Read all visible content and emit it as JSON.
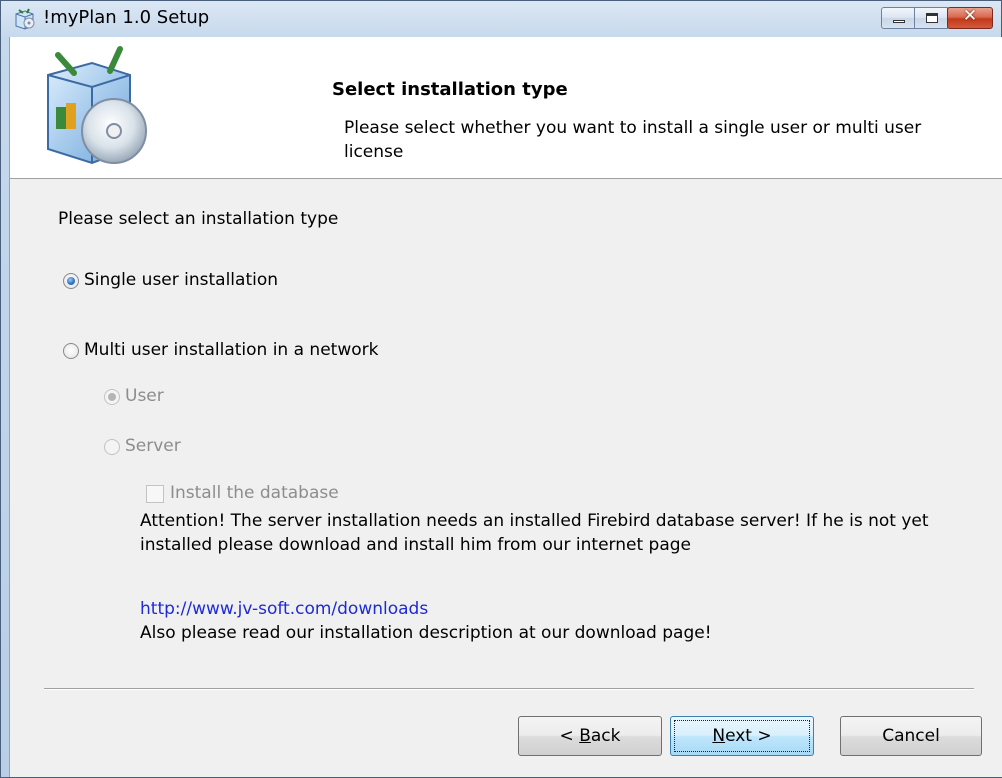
{
  "window": {
    "title": "!myPlan 1.0 Setup",
    "icon": "installer-box-icon",
    "controls": [
      "minimize-icon",
      "maximize-icon",
      "close-icon"
    ]
  },
  "header": {
    "title": "Select installation type",
    "subtitle": "Please select whether you want to install a single user or multi user license"
  },
  "body": {
    "prompt": "Please select an installation type",
    "options": [
      {
        "label": "Single user installation",
        "checked": true,
        "enabled": true
      },
      {
        "label": "Multi user installation in a network",
        "checked": false,
        "enabled": true
      }
    ],
    "suboptions": [
      {
        "label": "User",
        "checked": true,
        "enabled": false
      },
      {
        "label": "Server",
        "checked": false,
        "enabled": false
      }
    ],
    "install_db_label": "Install the database",
    "attention": "Attention! The server installation needs an installed Firebird database server! If he is not yet installed please download and install him from our internet page",
    "link": "http://www.jv-soft.com/downloads",
    "also": "Also please read our installation description at our download page!"
  },
  "buttons": {
    "back_prefix": "< ",
    "back_key": "B",
    "back_rest": "ack",
    "next_key": "N",
    "next_rest": "ext >",
    "cancel": "Cancel"
  },
  "colors": {
    "link": "#1d2ad8",
    "disabled_text": "#8d8d8d",
    "close_button": "#c2391b"
  }
}
